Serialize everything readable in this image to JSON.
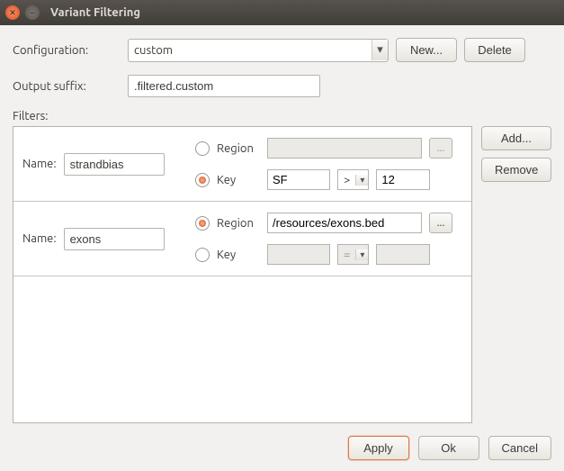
{
  "window": {
    "title": "Variant Filtering"
  },
  "config": {
    "label": "Configuration:",
    "value": "custom",
    "new_btn": "New...",
    "delete_btn": "Delete"
  },
  "output": {
    "label": "Output suffix:",
    "value": ".filtered.custom"
  },
  "filters": {
    "label": "Filters:",
    "add_btn": "Add...",
    "remove_btn": "Remove",
    "name_label": "Name:",
    "region_label": "Region",
    "key_label": "Key",
    "items": [
      {
        "name": "strandbias",
        "mode": "key",
        "region_path": "",
        "key_field": "SF",
        "key_op": ">",
        "key_value": "12"
      },
      {
        "name": "exons",
        "mode": "region",
        "region_path": "/resources/exons.bed",
        "key_field": "",
        "key_op": "=",
        "key_value": ""
      }
    ]
  },
  "footer": {
    "apply": "Apply",
    "ok": "Ok",
    "cancel": "Cancel"
  }
}
